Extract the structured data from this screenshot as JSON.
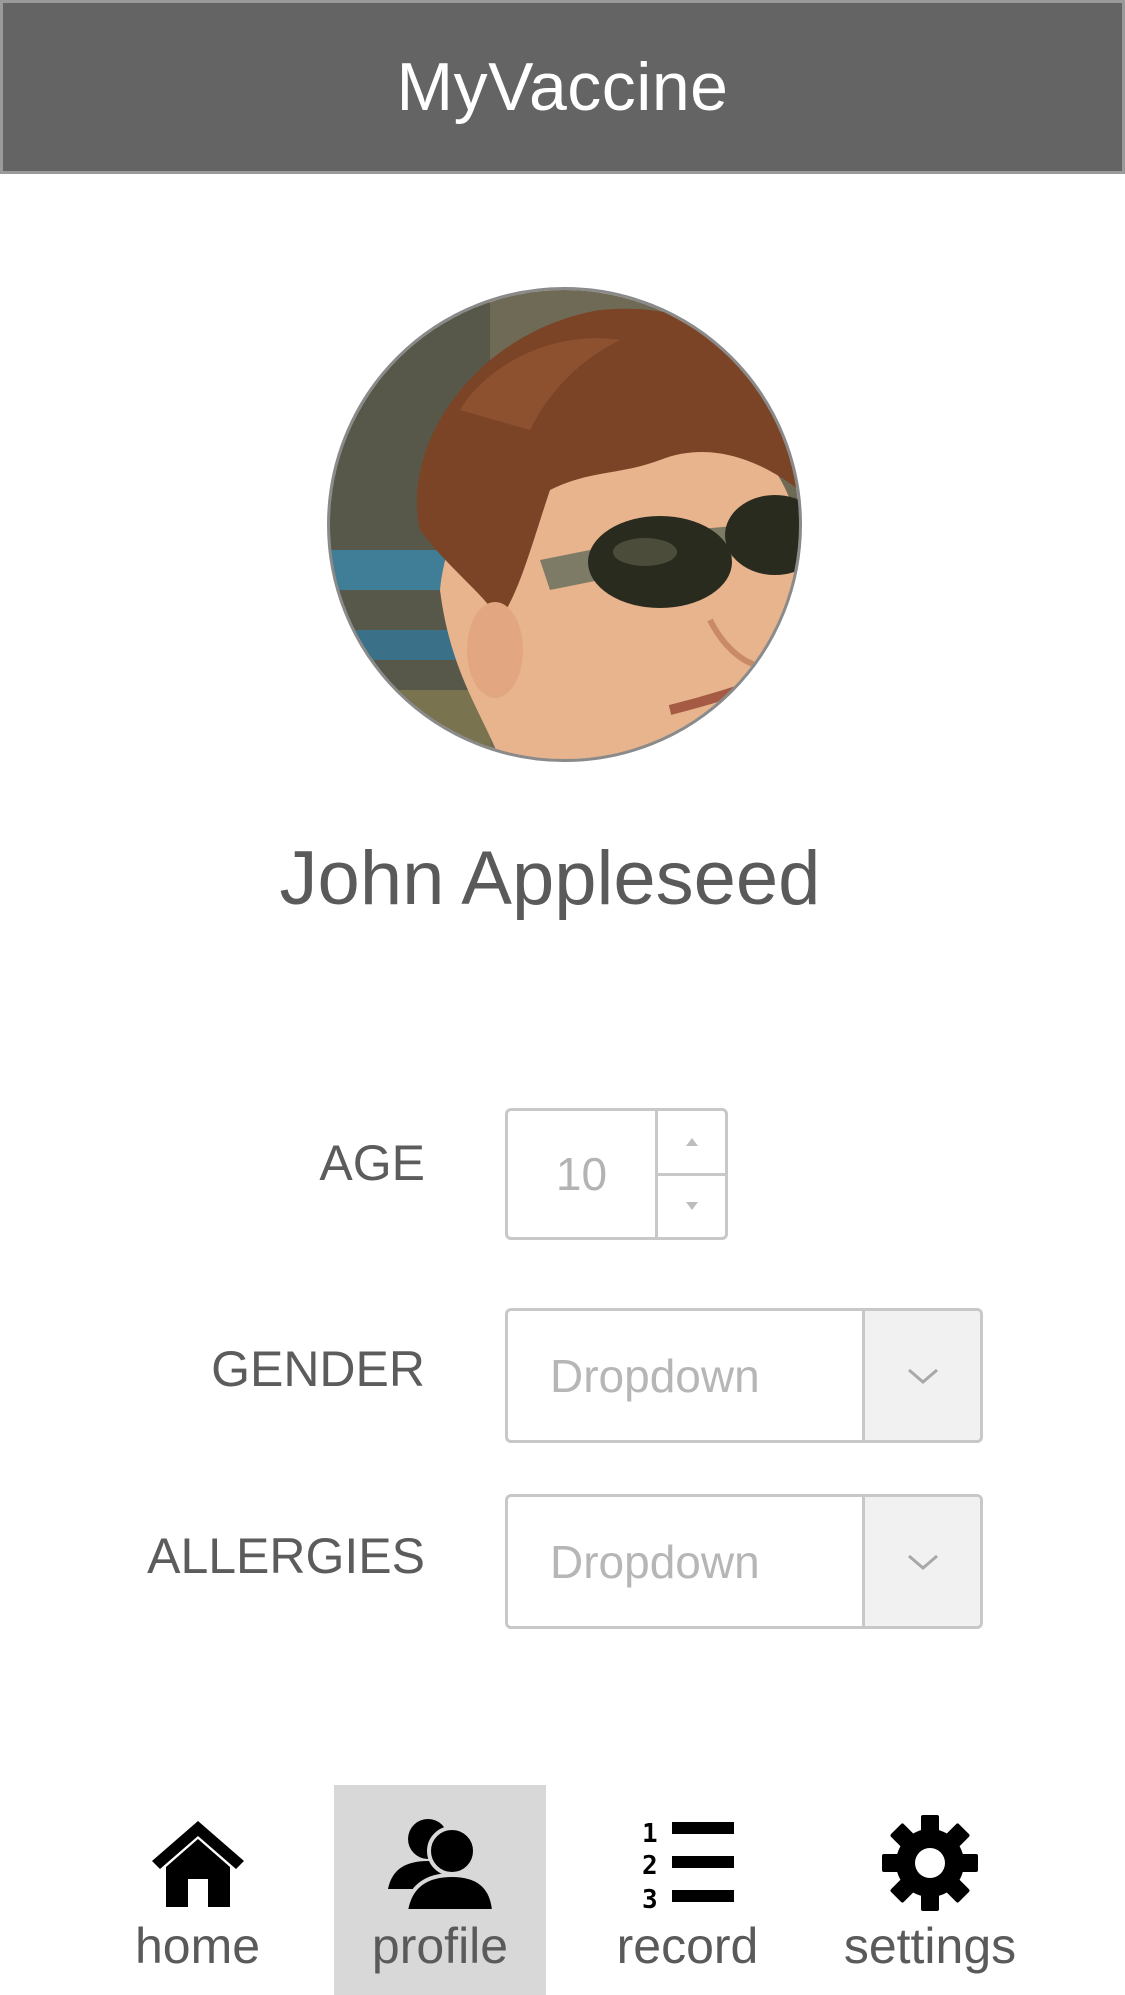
{
  "header": {
    "title": "MyVaccine"
  },
  "profile": {
    "name": "John Appleseed"
  },
  "form": {
    "age": {
      "label": "AGE",
      "value": "10"
    },
    "gender": {
      "label": "GENDER",
      "value": "Dropdown"
    },
    "allergies": {
      "label": "ALLERGIES",
      "value": "Dropdown"
    }
  },
  "nav": {
    "items": [
      {
        "label": "home",
        "icon": "home-icon",
        "active": false
      },
      {
        "label": "profile",
        "icon": "profile-icon",
        "active": true
      },
      {
        "label": "record",
        "icon": "record-icon",
        "active": false
      },
      {
        "label": "settings",
        "icon": "settings-icon",
        "active": false
      }
    ]
  },
  "colors": {
    "header_bg": "#646464",
    "active_tab_bg": "#d8d8d8",
    "text": "#5b5b5b",
    "placeholder": "#b6b6b6"
  }
}
